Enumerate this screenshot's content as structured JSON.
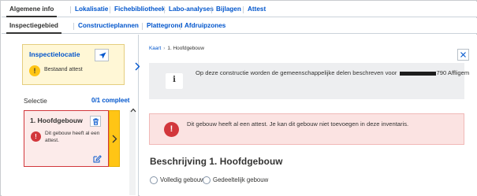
{
  "tabs_main": [
    {
      "label": "Algemene info",
      "active": true
    },
    {
      "label": "Lokalisatie",
      "active": false
    },
    {
      "label": "Fichebibliotheek",
      "active": false
    },
    {
      "label": "Labo-analyses",
      "active": false
    },
    {
      "label": "Bijlagen",
      "active": false
    },
    {
      "label": "Attest",
      "active": false
    }
  ],
  "tabs_sub": [
    {
      "label": "Inspectiegebied",
      "active": true
    },
    {
      "label": "Constructieplannen",
      "active": false
    },
    {
      "label": "Plattegrond",
      "active": false
    },
    {
      "label": "Afdruipzones",
      "active": false
    }
  ],
  "location_card": {
    "title": "Inspectielocatie",
    "status": "Bestaand attest",
    "status_icon": "!",
    "action_icon": "navigate-arrow-icon",
    "bg_color": "#fff7d6"
  },
  "selection": {
    "label": "Selectie",
    "count_selected": "0",
    "count_total": "/1 compleet"
  },
  "building_card": {
    "title": "1. Hoofdgebouw",
    "message": "Dit gebouw heeft al een attest.",
    "error_icon": "!",
    "bg_color": "#fcebea",
    "accent_color": "#ffc515"
  },
  "breadcrumb": {
    "root": "Kaart",
    "current": "1. Hoofdgebouw"
  },
  "info_notice": {
    "icon": "i",
    "text_before": "Op deze constructie worden de gemeenschappelijke delen beschreven voor",
    "text_after": "790 Affligem"
  },
  "error_notice": {
    "icon": "!",
    "text": "Dit gebouw heeft al een attest. Je kan dit gebouw niet toevoegen in deze inventaris."
  },
  "description": {
    "heading": "Beschrijving 1. Hoofdgebouw",
    "options": [
      "Volledig gebouw",
      "Gedeeltelijk gebouw"
    ]
  },
  "colors": {
    "link": "#0055cc",
    "error": "#d2373c",
    "warning": "#ffc515",
    "text": "#333332"
  }
}
